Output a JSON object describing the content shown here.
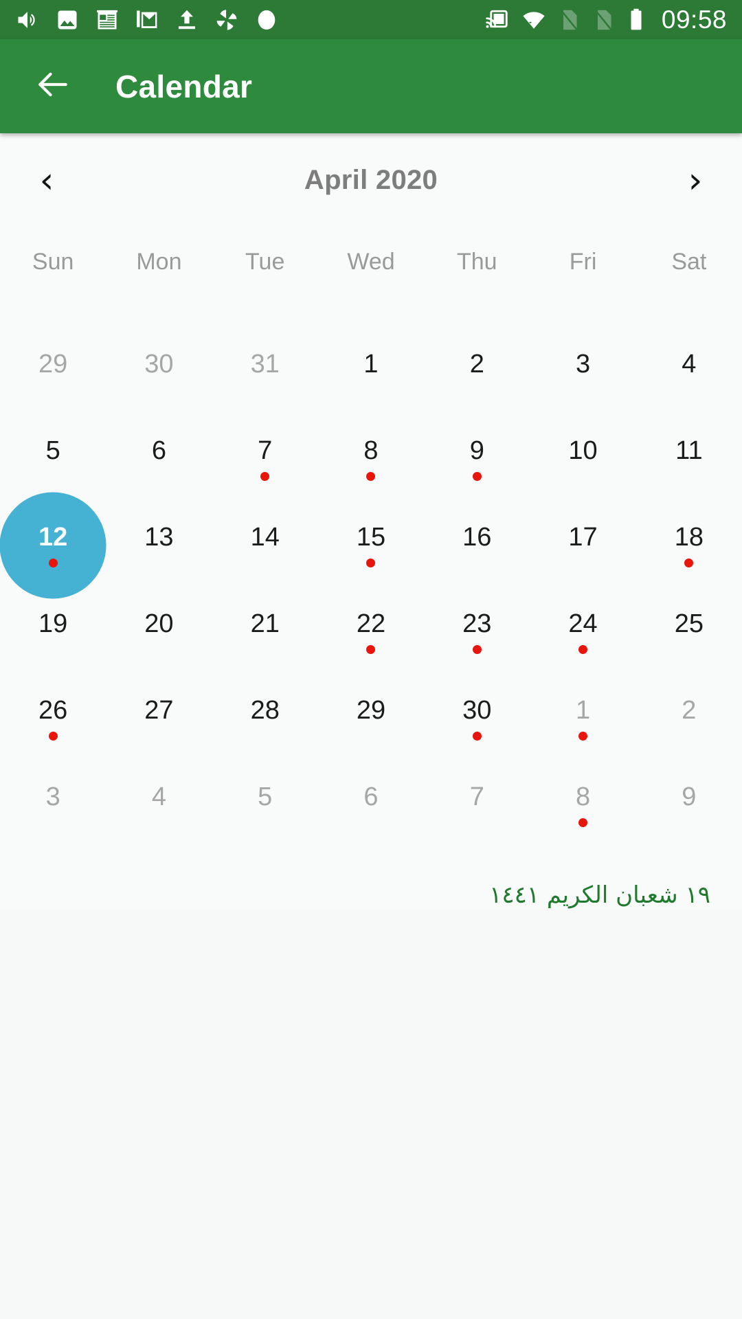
{
  "status_bar": {
    "background": "#2d7a37",
    "time": "09:58",
    "left_icons": [
      {
        "name": "volume-icon"
      },
      {
        "name": "photo-icon"
      },
      {
        "name": "news-icon"
      },
      {
        "name": "gmail-icon"
      },
      {
        "name": "upload-icon"
      },
      {
        "name": "pinwheel-icon"
      },
      {
        "name": "circle-icon"
      }
    ],
    "right_icons": [
      {
        "name": "cast-icon"
      },
      {
        "name": "wifi-icon"
      },
      {
        "name": "sim-card-1-disabled-icon"
      },
      {
        "name": "sim-card-2-disabled-icon"
      },
      {
        "name": "battery-icon"
      }
    ]
  },
  "app_bar": {
    "background": "#2e8b3d",
    "back_icon": "back-arrow-icon",
    "title": "Calendar"
  },
  "calendar": {
    "prev_label": "‹",
    "next_label": "›",
    "month_label": "April 2020",
    "weekdays": [
      "Sun",
      "Mon",
      "Tue",
      "Wed",
      "Thu",
      "Fri",
      "Sat"
    ],
    "selected_color": "#45b2d3",
    "event_dot_color": "#e8150d",
    "outside_color": "#a6a6a6",
    "hijri_color": "#1f7a2e",
    "hijri_date": "١٩ شعبان الكريم ١٤٤١",
    "weeks": [
      [
        {
          "day": "29",
          "outside": true,
          "event": false,
          "selected": false
        },
        {
          "day": "30",
          "outside": true,
          "event": false,
          "selected": false
        },
        {
          "day": "31",
          "outside": true,
          "event": false,
          "selected": false
        },
        {
          "day": "1",
          "outside": false,
          "event": false,
          "selected": false
        },
        {
          "day": "2",
          "outside": false,
          "event": false,
          "selected": false
        },
        {
          "day": "3",
          "outside": false,
          "event": false,
          "selected": false
        },
        {
          "day": "4",
          "outside": false,
          "event": false,
          "selected": false
        }
      ],
      [
        {
          "day": "5",
          "outside": false,
          "event": false,
          "selected": false
        },
        {
          "day": "6",
          "outside": false,
          "event": false,
          "selected": false
        },
        {
          "day": "7",
          "outside": false,
          "event": true,
          "selected": false
        },
        {
          "day": "8",
          "outside": false,
          "event": true,
          "selected": false
        },
        {
          "day": "9",
          "outside": false,
          "event": true,
          "selected": false
        },
        {
          "day": "10",
          "outside": false,
          "event": false,
          "selected": false
        },
        {
          "day": "11",
          "outside": false,
          "event": false,
          "selected": false
        }
      ],
      [
        {
          "day": "12",
          "outside": false,
          "event": true,
          "selected": true
        },
        {
          "day": "13",
          "outside": false,
          "event": false,
          "selected": false
        },
        {
          "day": "14",
          "outside": false,
          "event": false,
          "selected": false
        },
        {
          "day": "15",
          "outside": false,
          "event": true,
          "selected": false
        },
        {
          "day": "16",
          "outside": false,
          "event": false,
          "selected": false
        },
        {
          "day": "17",
          "outside": false,
          "event": false,
          "selected": false
        },
        {
          "day": "18",
          "outside": false,
          "event": true,
          "selected": false
        }
      ],
      [
        {
          "day": "19",
          "outside": false,
          "event": false,
          "selected": false
        },
        {
          "day": "20",
          "outside": false,
          "event": false,
          "selected": false
        },
        {
          "day": "21",
          "outside": false,
          "event": false,
          "selected": false
        },
        {
          "day": "22",
          "outside": false,
          "event": true,
          "selected": false
        },
        {
          "day": "23",
          "outside": false,
          "event": true,
          "selected": false
        },
        {
          "day": "24",
          "outside": false,
          "event": true,
          "selected": false
        },
        {
          "day": "25",
          "outside": false,
          "event": false,
          "selected": false
        }
      ],
      [
        {
          "day": "26",
          "outside": false,
          "event": true,
          "selected": false
        },
        {
          "day": "27",
          "outside": false,
          "event": false,
          "selected": false
        },
        {
          "day": "28",
          "outside": false,
          "event": false,
          "selected": false
        },
        {
          "day": "29",
          "outside": false,
          "event": false,
          "selected": false
        },
        {
          "day": "30",
          "outside": false,
          "event": true,
          "selected": false
        },
        {
          "day": "1",
          "outside": true,
          "event": true,
          "selected": false
        },
        {
          "day": "2",
          "outside": true,
          "event": false,
          "selected": false
        }
      ],
      [
        {
          "day": "3",
          "outside": true,
          "event": false,
          "selected": false
        },
        {
          "day": "4",
          "outside": true,
          "event": false,
          "selected": false
        },
        {
          "day": "5",
          "outside": true,
          "event": false,
          "selected": false
        },
        {
          "day": "6",
          "outside": true,
          "event": false,
          "selected": false
        },
        {
          "day": "7",
          "outside": true,
          "event": false,
          "selected": false
        },
        {
          "day": "8",
          "outside": true,
          "event": true,
          "selected": false
        },
        {
          "day": "9",
          "outside": true,
          "event": false,
          "selected": false
        }
      ]
    ]
  }
}
